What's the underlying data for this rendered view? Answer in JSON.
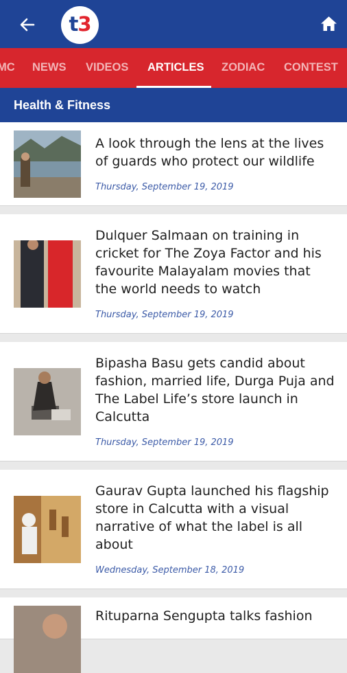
{
  "header": {
    "logo_text_a": "t",
    "logo_text_b": "3",
    "back_icon": "arrow-left-icon",
    "home_icon": "home-icon"
  },
  "tabs": [
    {
      "label": "MC"
    },
    {
      "label": "NEWS"
    },
    {
      "label": "VIDEOS"
    },
    {
      "label": "ARTICLES",
      "active": true
    },
    {
      "label": "ZODIAC"
    },
    {
      "label": "CONTEST"
    }
  ],
  "section": {
    "title": "Health & Fitness"
  },
  "articles": [
    {
      "title": "A look through the lens at the lives of guards who protect our wildlife",
      "date": "Thursday, September 19, 2019"
    },
    {
      "title": "Dulquer Salmaan on training in cricket for The Zoya Factor and his favourite Malayalam movies that the world needs to watch",
      "date": "Thursday, September 19, 2019"
    },
    {
      "title": "Bipasha Basu gets candid about fashion, married life, Durga Puja and The Label Life’s store launch in Calcutta",
      "date": "Thursday, September 19, 2019"
    },
    {
      "title": "Gaurav Gupta launched his flagship store in Calcutta with a visual narrative of what the label is all about",
      "date": "Wednesday, September 18, 2019"
    },
    {
      "title": "Rituparna Sengupta talks fashion",
      "date": ""
    }
  ],
  "colors": {
    "header_blue": "#1f4496",
    "tab_red": "#d7262d",
    "date_blue": "#3b5aa7"
  }
}
